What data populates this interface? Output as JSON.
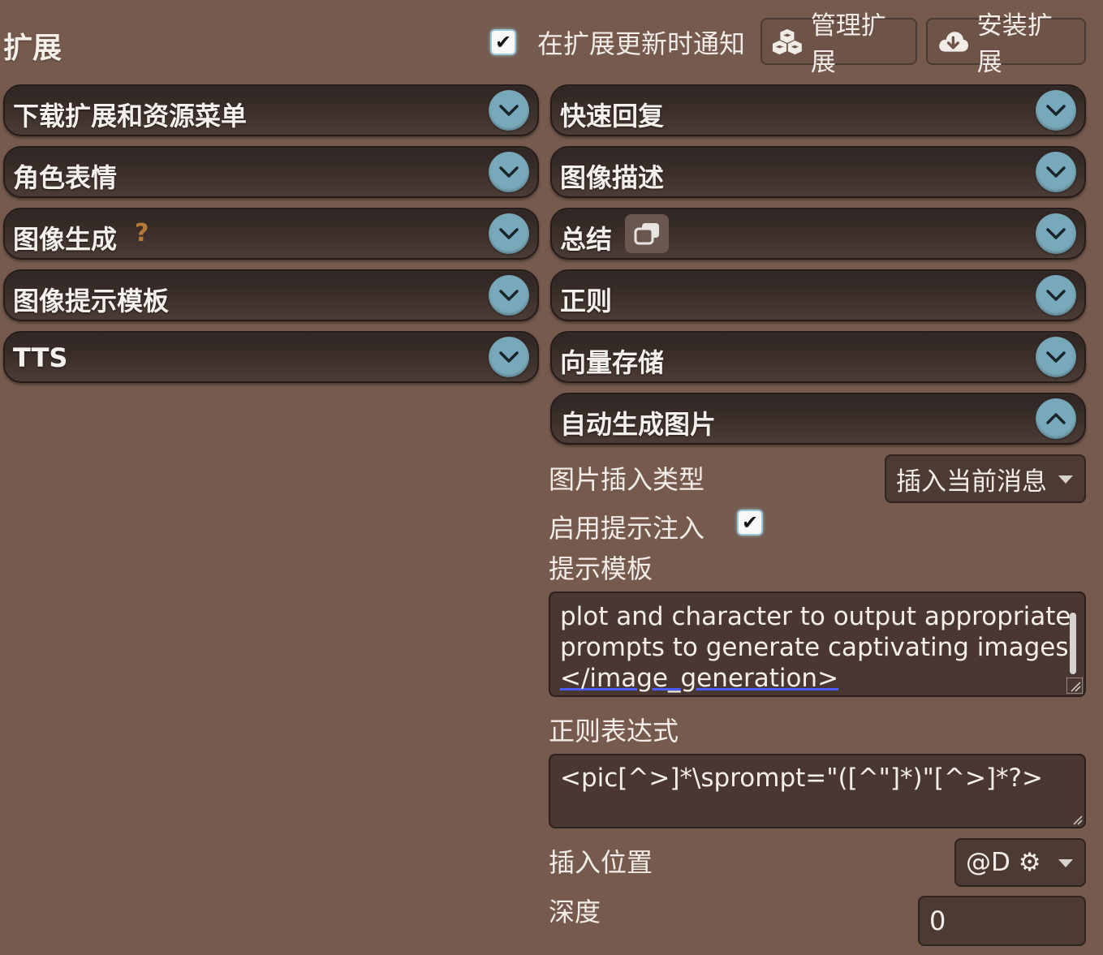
{
  "header": {
    "title": "扩展",
    "notify_checked": true,
    "notify_label": "在扩展更新时通知",
    "manage_label": "管理扩展",
    "install_label": "安装扩展"
  },
  "drawers": {
    "left": [
      {
        "label": "下载扩展和资源菜单",
        "expanded": false
      },
      {
        "label": "角色表情",
        "expanded": false
      },
      {
        "label": "图像生成",
        "expanded": false,
        "help": "?"
      },
      {
        "label": "图像提示模板",
        "expanded": false
      },
      {
        "label": "TTS",
        "expanded": false
      }
    ],
    "right": [
      {
        "label": "快速回复",
        "expanded": false
      },
      {
        "label": "图像描述",
        "expanded": false
      },
      {
        "label": "总结",
        "expanded": false,
        "icon": "copy-icon"
      },
      {
        "label": "正则",
        "expanded": false
      },
      {
        "label": "向量存储",
        "expanded": false
      },
      {
        "label": "自动生成图片",
        "expanded": true
      }
    ]
  },
  "auto_image": {
    "insert_type_label": "图片插入类型",
    "insert_type_value": "插入当前消息",
    "enable_injection_label": "启用提示注入",
    "enable_injection_checked": true,
    "template_label": "提示模板",
    "template_lines": [
      "plot and character to output appropriate",
      "prompts to generate captivating images.",
      "</image_generation>"
    ],
    "regex_label": "正则表达式",
    "regex_value": "<pic[^>]*\\sprompt=\"([^\"]*)\"[^>]*?>",
    "position_label": "插入位置",
    "position_value": "@D ⚙",
    "depth_label": "深度",
    "depth_value": "0"
  },
  "colors": {
    "background": "#765a4e",
    "drawer_toggle": "#78a9ba",
    "help_mark": "#b57b36"
  }
}
